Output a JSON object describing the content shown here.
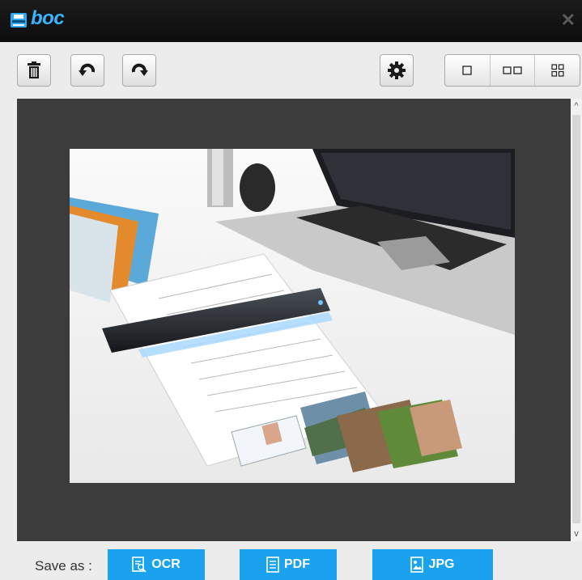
{
  "app": {
    "name": "boc",
    "logo_icon": "scanner-icon",
    "close_icon": "close-icon",
    "accent": "#1aa2ee"
  },
  "toolbar": {
    "buttons": [
      {
        "name": "delete",
        "icon": "trash-icon"
      },
      {
        "name": "rotate-left",
        "icon": "rotate-ccw-icon"
      },
      {
        "name": "rotate-right",
        "icon": "rotate-cw-icon"
      },
      {
        "name": "settings",
        "icon": "gear-icon"
      }
    ],
    "view_modes": [
      {
        "name": "single",
        "icon": "single-page-icon"
      },
      {
        "name": "double",
        "icon": "two-page-icon"
      },
      {
        "name": "grid",
        "icon": "grid-view-icon"
      }
    ]
  },
  "preview": {
    "image_alt": "Portable scanner on desk scanning a form, with laptop, folders, photos and ID card"
  },
  "bottom": {
    "save_label": "Save as :",
    "ocr_label": "OCR",
    "pdf_label": "PDF",
    "jpg_label": "JPG"
  }
}
